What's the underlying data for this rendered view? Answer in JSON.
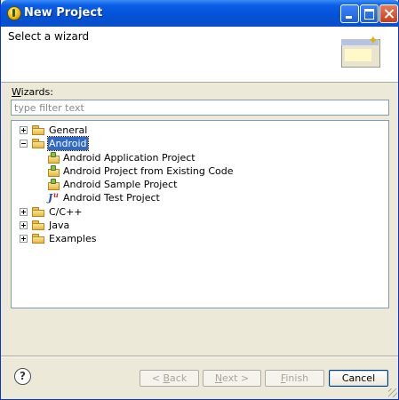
{
  "window": {
    "title": "New Project"
  },
  "header": {
    "title": "Select a wizard"
  },
  "wizards": {
    "label_prefix": "W",
    "label_rest": "izards:"
  },
  "filter": {
    "placeholder": "type filter text",
    "value": ""
  },
  "tree": {
    "general": "General",
    "android": "Android",
    "android_children": [
      "Android Application Project",
      "Android Project from Existing Code",
      "Android Sample Project",
      "Android Test Project"
    ],
    "cpp": "C/C++",
    "java": "Java",
    "examples": "Examples"
  },
  "buttons": {
    "back_pre": "< ",
    "back_ul": "B",
    "back_post": "ack",
    "next_ul": "N",
    "next_post": "ext >",
    "finish_ul": "F",
    "finish_post": "inish",
    "cancel": "Cancel"
  },
  "help": {
    "glyph": "?"
  },
  "colors": {
    "selection": "#316ac5",
    "titlebar": "#0252d6"
  }
}
